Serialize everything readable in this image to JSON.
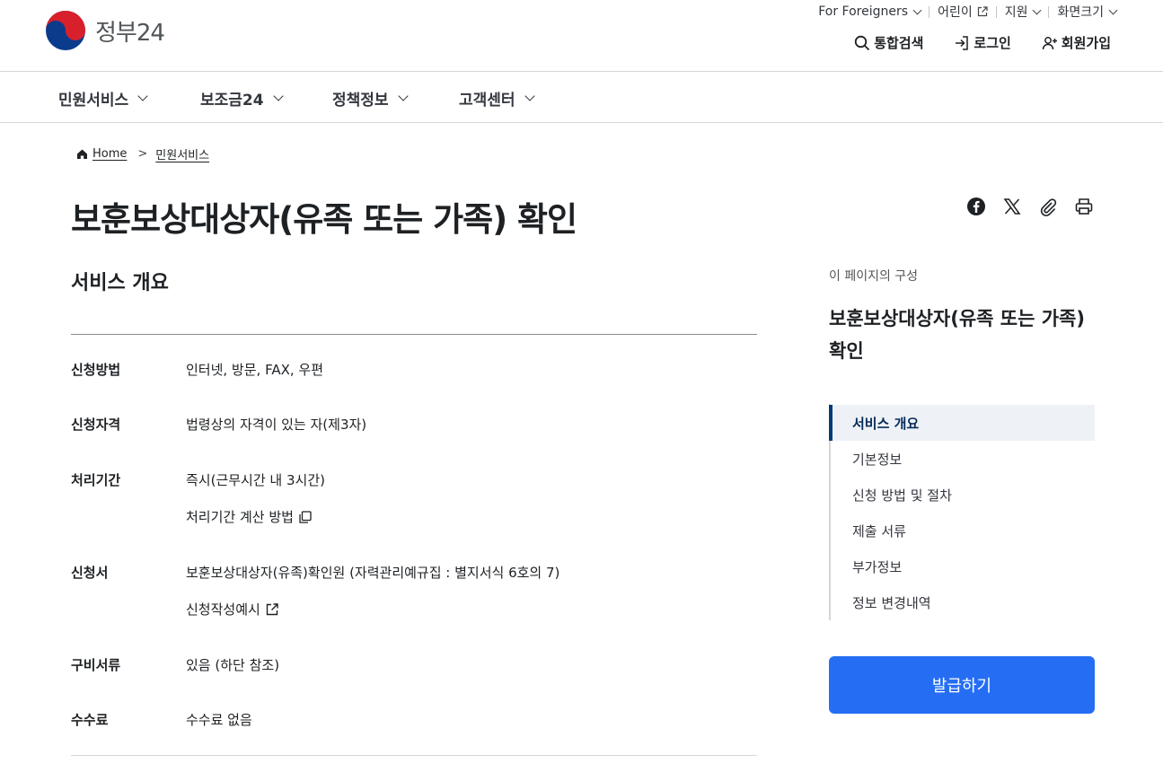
{
  "header": {
    "logo_text": "정부24",
    "util_links": [
      {
        "label": "For Foreigners",
        "icon": "chevron-down-icon"
      },
      {
        "label": "어린이",
        "icon": "external-link-icon"
      },
      {
        "label": "지원",
        "icon": "chevron-down-icon"
      },
      {
        "label": "화면크기",
        "icon": "chevron-down-icon"
      }
    ],
    "actions": {
      "search": "통합검색",
      "login": "로그인",
      "signup": "회원가입"
    }
  },
  "gnb": [
    "민원서비스",
    "보조금24",
    "정책정보",
    "고객센터"
  ],
  "breadcrumb": {
    "home": "Home",
    "current": "민원서비스",
    "separator": ">"
  },
  "page_title": "보훈보상대상자(유족 또는 가족) 확인",
  "share_icons": [
    "facebook-icon",
    "x-icon",
    "link-icon",
    "print-icon"
  ],
  "overview": {
    "section_title": "서비스 개요",
    "rows": [
      {
        "label": "신청방법",
        "value": "인터넷, 방문, FAX, 우편"
      },
      {
        "label": "신청자격",
        "value": "법령상의 자격이 있는 자(제3자)"
      },
      {
        "label": "처리기간",
        "value": "즉시(근무시간 내 3시간)",
        "link": "처리기간 계산 방법"
      },
      {
        "label": "신청서",
        "value": "보훈보상대상자(유족)확인원 (자력관리예규집 : 별지서식 6호의 7)",
        "link": "신청작성예시"
      },
      {
        "label": "구비서류",
        "value": "있음 (하단 참조)"
      },
      {
        "label": "수수료",
        "value": "수수료 없음"
      }
    ]
  },
  "toc": {
    "caption": "이 페이지의 구성",
    "title": "보훈보상대상자(유족 또는 가족) 확인",
    "items": [
      "서비스 개요",
      "기본정보",
      "신청 방법 및 절차",
      "제출 서류",
      "부가정보",
      "정보 변경내역"
    ],
    "active_index": 0
  },
  "issue_button": "발급하기",
  "colors": {
    "primary": "#256ef4",
    "active_nav": "#063a74",
    "text": "#1e2124"
  }
}
